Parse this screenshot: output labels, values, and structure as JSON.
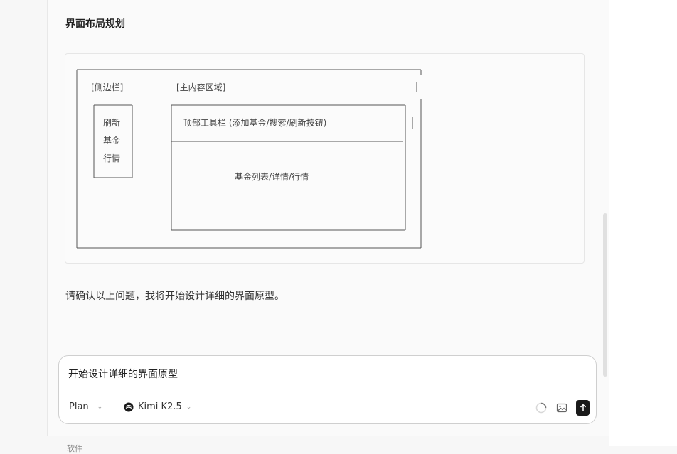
{
  "section": {
    "title": "界面布局规划"
  },
  "diagram": {
    "sidebar_label": "[侧边栏]",
    "main_label": "[主内容区域]",
    "sidebar_items": [
      "刷新",
      "基金",
      "行情"
    ],
    "toolbar_label": "顶部工具栏 (添加基金/搜索/刷新按钮)",
    "content_label": "基金列表/详情/行情"
  },
  "message": {
    "confirm_text": "请确认以上问题，我将开始设计详细的界面原型。"
  },
  "composer": {
    "input_value": "开始设计详细的界面原型",
    "mode_label": "Plan",
    "model_label": "Kimi K2.5"
  },
  "footer": {
    "text": "软件"
  },
  "icons": {
    "mode_dropdown": "chevron-down-icon",
    "model_logo": "kimi-logo-icon",
    "spinner": "loading-spinner-icon",
    "image": "image-icon",
    "send": "arrow-up-icon"
  },
  "colors": {
    "send_button": "#1a1a1a",
    "panel_bg": "#fafafa"
  }
}
